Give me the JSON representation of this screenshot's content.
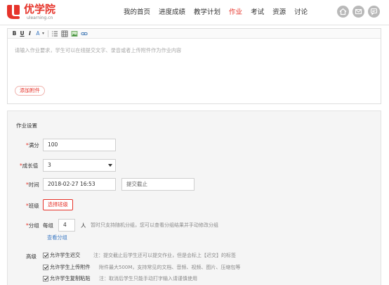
{
  "header": {
    "logo_text": "优学院",
    "logo_sub": "ulearning.cn",
    "nav": [
      {
        "label": "我的首页"
      },
      {
        "label": "进度成绩"
      },
      {
        "label": "教学计划"
      },
      {
        "label": "作业"
      },
      {
        "label": "考试"
      },
      {
        "label": "资源"
      },
      {
        "label": "讨论"
      }
    ],
    "active_nav": "作业",
    "icons": [
      "home-icon",
      "mail-icon",
      "message-icon"
    ],
    "accent_color": "#e6332a"
  },
  "editor": {
    "toolbar": {
      "bold": "B",
      "underline": "U",
      "italic": "I",
      "font_color": "A",
      "items": [
        "bold-icon",
        "underline-icon",
        "italic-icon",
        "font-color-icon",
        "list-icon",
        "table-icon",
        "image-icon",
        "link-icon"
      ]
    },
    "placeholder": "请输入作业要求，学生可以在线提交文字、录音或者上传附件作为作业内容",
    "attach_label": "添加附件"
  },
  "settings": {
    "title": "作业设置",
    "full_score": {
      "label": "满分",
      "value": "100"
    },
    "growth": {
      "label": "成长值",
      "value": "3"
    },
    "time": {
      "label": "时间",
      "start_value": "2018-02-27 16:53",
      "end_placeholder": "提交截止"
    },
    "class": {
      "label": "班级",
      "button": "选择班级"
    },
    "group": {
      "label": "分组",
      "prefix": "每组",
      "value": "4",
      "unit": "人",
      "hint": "暂时只支持随机分组，您可以查看分组结果并手动修改分组",
      "link": "查看分组"
    },
    "advanced": {
      "label": "高级",
      "options": [
        {
          "label": "允许学生迟交",
          "checked": true,
          "hint": "注：提交截止后学生还可以提交作业，但是会标上【迟交】的标签"
        },
        {
          "label": "允许学生上传附件",
          "checked": true,
          "hint": "附件最大500M，支持常见的文档、音频、视频、图片、压缩包等"
        },
        {
          "label": "允许学生复制粘贴",
          "checked": true,
          "hint": "注：取消后学生只能手动打字输入请谨慎使用"
        }
      ]
    }
  }
}
